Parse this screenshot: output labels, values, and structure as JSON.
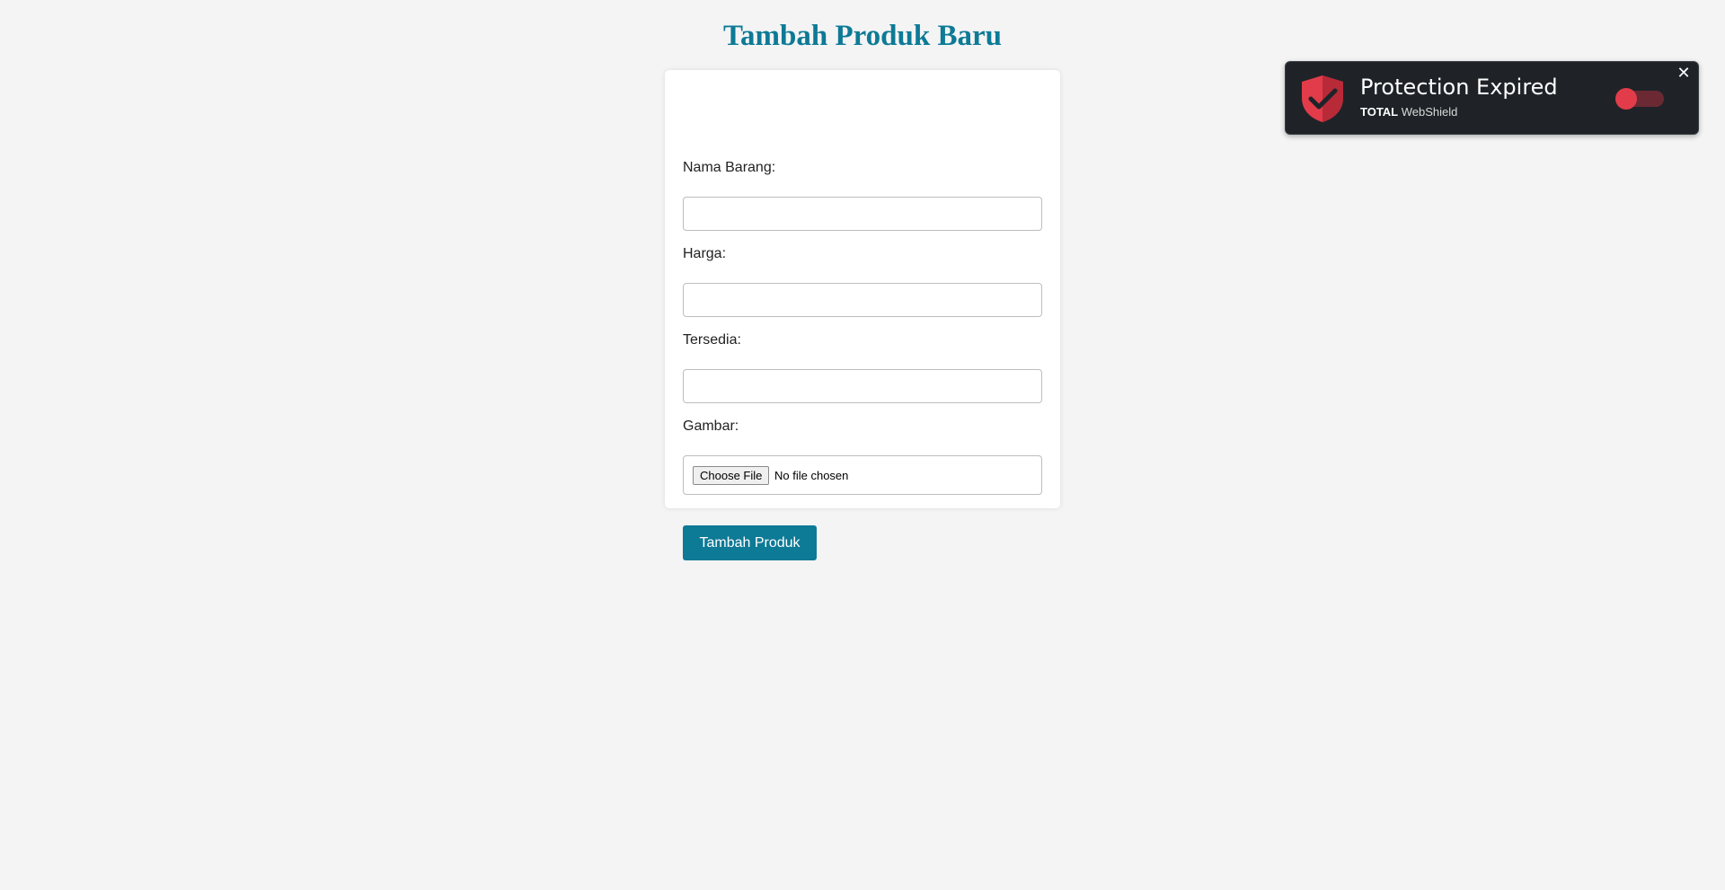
{
  "page": {
    "title": "Tambah Produk Baru"
  },
  "form": {
    "fields": [
      {
        "label": "Nama Barang:",
        "value": "",
        "placeholder": ""
      },
      {
        "label": "Harga:",
        "value": "",
        "placeholder": ""
      },
      {
        "label": "Tersedia:",
        "value": "",
        "placeholder": ""
      }
    ],
    "image": {
      "label": "Gambar:",
      "button_label": "Choose File",
      "status": "No file chosen"
    },
    "submit_label": "Tambah Produk"
  },
  "toast": {
    "title": "Protection Expired",
    "brand_bold": "TOTAL",
    "brand_rest": "WebShield",
    "close_symbol": "✕",
    "toggle_on": false,
    "icon": "shield-check-icon",
    "colors": {
      "background": "#1f2328",
      "shield": "#e23c4b",
      "toggle_knob": "#e23c4b"
    }
  },
  "colors": {
    "accent": "#0d7a96",
    "background": "#f4f4f4"
  }
}
